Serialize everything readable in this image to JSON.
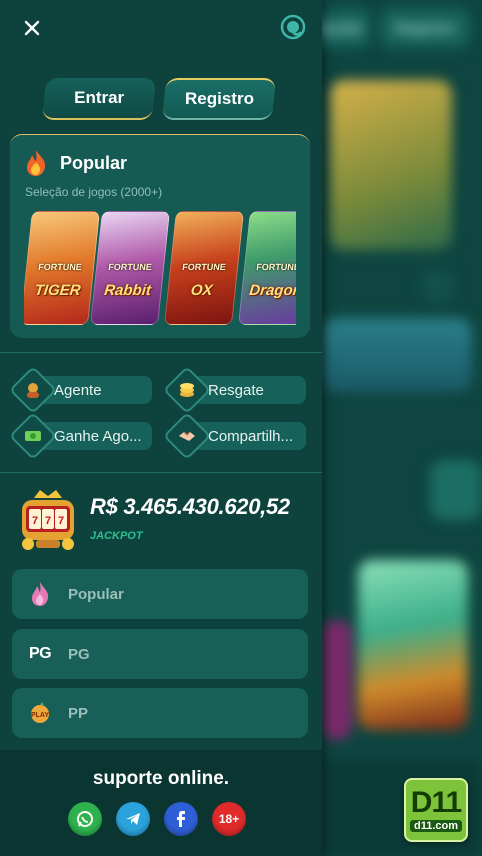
{
  "background_app": {
    "tabs": [
      "Popular",
      "Registro"
    ],
    "badge_big": "D11",
    "badge_small": "d11.com"
  },
  "drawer": {
    "close_icon": "close-icon",
    "support_icon": "customer-support-icon",
    "auth": {
      "login_label": "Entrar",
      "register_label": "Registro"
    },
    "popular": {
      "title": "Popular",
      "subtitle": "Seleção de jogos (2000+)",
      "games": [
        {
          "name": "Fortune Tiger",
          "big": "TIGER",
          "small": "FORTUNE"
        },
        {
          "name": "Fortune Rabbit",
          "big": "Rabbit",
          "small": "FORTUNE"
        },
        {
          "name": "Fortune Ox",
          "big": "OX",
          "small": "FORTUNE"
        },
        {
          "name": "Fortune Dragon",
          "big": "Dragon",
          "small": "FORTUNE"
        }
      ]
    },
    "menu": {
      "agent": "Agente",
      "redeem": "Resgate",
      "earn": "Ganhe Ago...",
      "share": "Compartilh..."
    },
    "jackpot": {
      "amount": "R$ 3.465.430.620,52",
      "label": "JACKPOT"
    },
    "categories": [
      {
        "label": "Popular",
        "icon": "flame-icon"
      },
      {
        "label": "PG",
        "icon": "pg-logo-icon",
        "icon_text": "PG"
      },
      {
        "label": "PP",
        "icon": "pp-logo-icon"
      }
    ],
    "footer": {
      "title": "suporte online.",
      "social": [
        "whatsapp-icon",
        "telegram-icon",
        "facebook-icon",
        "18-plus-icon"
      ],
      "age_text": "18+"
    }
  },
  "colors": {
    "accent_gold": "#d9c15c",
    "drawer_bg": "#0d423d",
    "jackpot_green": "#2bc08f"
  }
}
